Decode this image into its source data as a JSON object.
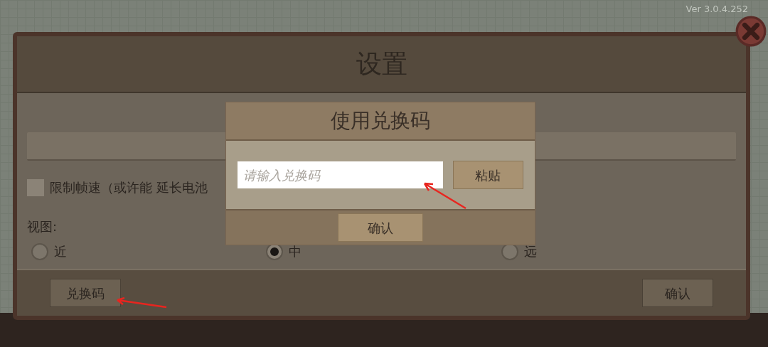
{
  "version": "Ver 3.0.4.252",
  "settings": {
    "title": "设置",
    "limit_frame_rate": {
      "label": "限制帧速（或许能 延长电池",
      "checked": false
    },
    "view": {
      "label": "视图:",
      "options": [
        {
          "label": "近",
          "selected": false
        },
        {
          "label": "中",
          "selected": true
        },
        {
          "label": "远",
          "selected": false
        }
      ]
    },
    "buttons": [
      {
        "label": "兑换码"
      },
      {
        "label": "确认"
      }
    ]
  },
  "redeem_dialog": {
    "title": "使用兑换码",
    "placeholder": "请输入兑换码",
    "paste_button": "粘贴",
    "confirm_button": "确认"
  }
}
